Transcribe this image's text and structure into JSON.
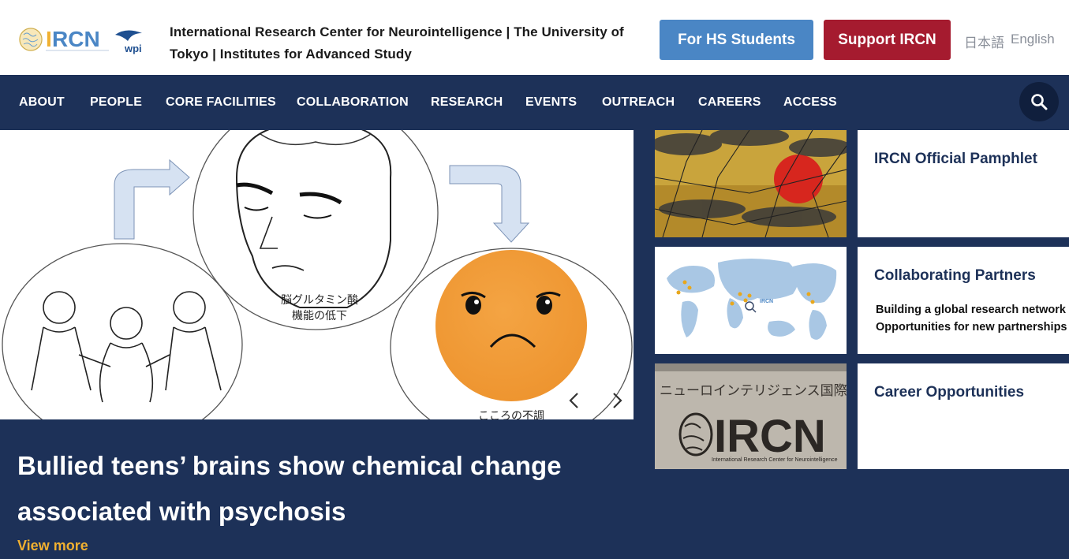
{
  "header": {
    "logo_text": "IRCN",
    "logo_sub": "wpi",
    "title": "International Research Center for Neurointelligence | The University of Tokyo | Institutes for Advanced Study",
    "hs_button": "For HS Students",
    "support_button": "Support IRCN",
    "lang_ja": "日本語",
    "lang_en": "English"
  },
  "nav": {
    "items": [
      {
        "label": "ABOUT"
      },
      {
        "label": "PEOPLE"
      },
      {
        "label": "CORE FACILITIES"
      },
      {
        "label": "COLLABORATION"
      },
      {
        "label": "RESEARCH"
      },
      {
        "label": "EVENTS"
      },
      {
        "label": "OUTREACH"
      },
      {
        "label": "CAREERS"
      },
      {
        "label": "ACCESS"
      }
    ]
  },
  "hero": {
    "caption_line1": "脳グルタミン酸",
    "caption_line2": "機能の低下",
    "caption_bottom": "こころの不調",
    "title": "Bullied teens’ brains show chemical change associated with psychosis",
    "view_more": "View more"
  },
  "side": {
    "cards": [
      {
        "title": "IRCN Official Pamphlet"
      },
      {
        "title": "Collaborating Partners",
        "sub1": "Building a global research network",
        "sub2": "Opportunities for new partnerships"
      },
      {
        "title": "Career Opportunities"
      }
    ],
    "sign_text": "ニューロインテリジェンス国際研究",
    "sign_logo": "IRCN",
    "sign_sub": "International Research Center for Neurointelligence"
  },
  "colors": {
    "navy": "#1d3158",
    "hs_blue": "#4a86c5",
    "support_red": "#a51b2f",
    "accent_yellow": "#f0b030"
  }
}
